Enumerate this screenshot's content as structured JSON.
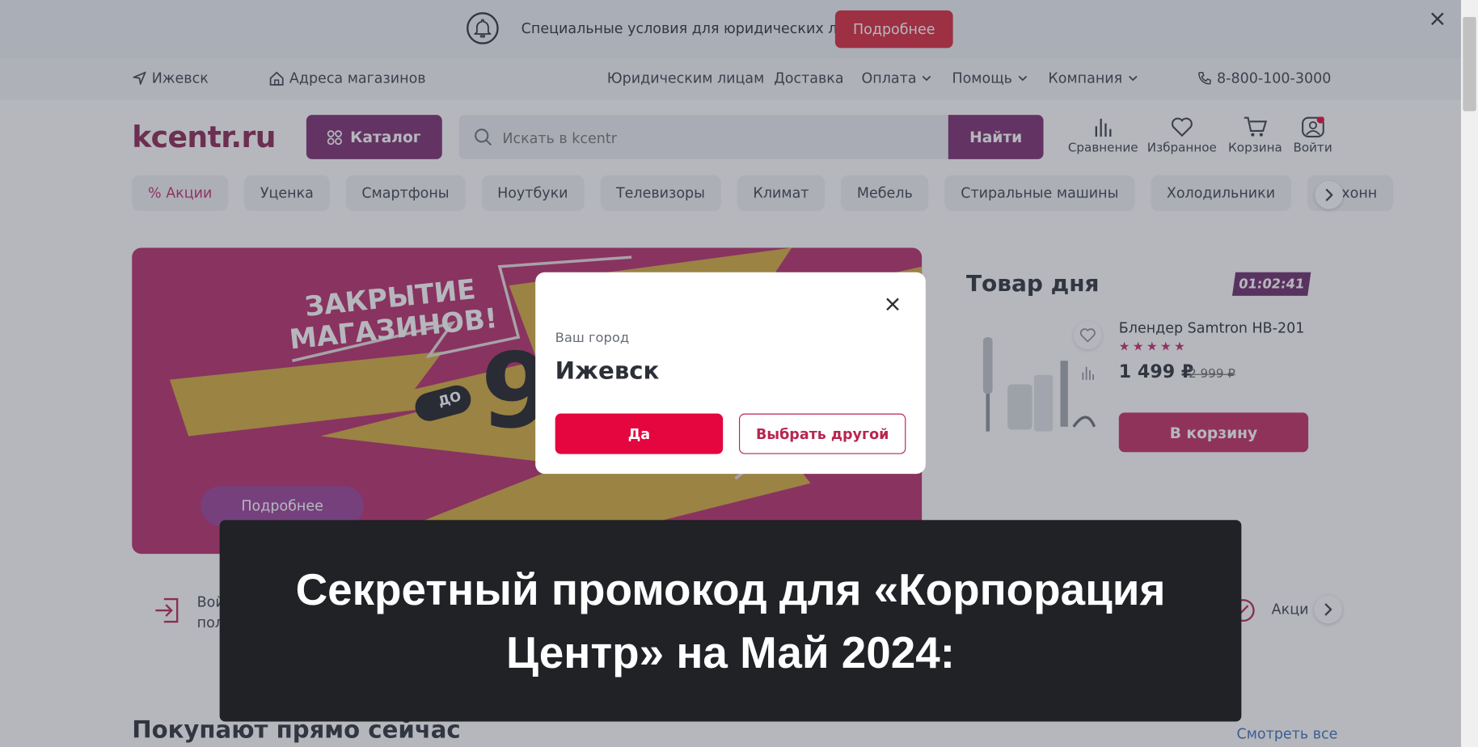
{
  "top_banner": {
    "text": "Специальные условия для юридических лиц",
    "button": "Подробнее"
  },
  "topnav": {
    "city": "Ижевск",
    "stores": "Адреса магазинов",
    "legal": "Юридическим лицам",
    "delivery": "Доставка",
    "payment": "Оплата",
    "help": "Помощь",
    "company": "Компания",
    "phone": "8-800-100-3000"
  },
  "header": {
    "logo": "kcentr.ru",
    "catalog": "Каталог",
    "search_placeholder": "Искать в kcentr",
    "find": "Найти",
    "compare": "Сравнение",
    "favorites": "Избранное",
    "cart": "Корзина",
    "login": "Войти"
  },
  "categories": [
    "% Акции",
    "Уценка",
    "Смартфоны",
    "Ноутбуки",
    "Телевизоры",
    "Климат",
    "Мебель",
    "Стиральные машины",
    "Холодильники",
    "Кухонн"
  ],
  "promo": {
    "title_line1": "ЗАКРЫТИЕ",
    "title_line2": "МАГАЗИНОВ!",
    "badge": "ДО",
    "button": "Подробнее"
  },
  "deal_of_day": {
    "title": "Товар дня",
    "timer": "01:02:41",
    "product": "Блендер Samtron HB-201",
    "stars": "★★★★★",
    "price": "1 499 ₽",
    "old_price": "2 999 ₽",
    "cart_button": "В корзину"
  },
  "strip": {
    "login_text1": "Вой",
    "login_text2": "пол",
    "promo_text": "Акци"
  },
  "section": {
    "title": "Покупают прямо сейчас",
    "see_all": "Смотреть все"
  },
  "modal": {
    "label": "Ваш город",
    "city": "Ижевск",
    "yes": "Да",
    "other": "Выбрать другой"
  },
  "caption": {
    "text": "Секретный промокод для «Корпорация Центр» на Май 2024:"
  },
  "colors": {
    "brand": "#7b2d6e",
    "accent": "#e5063f",
    "promo_bg": "#b82a6a"
  }
}
